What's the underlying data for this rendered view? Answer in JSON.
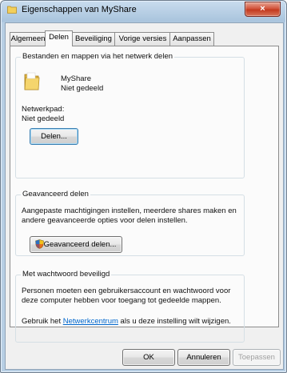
{
  "window": {
    "title": "Eigenschappen van MyShare",
    "close_glyph": "×"
  },
  "tabs": [
    {
      "label": "Algemeen"
    },
    {
      "label": "Delen"
    },
    {
      "label": "Beveiliging"
    },
    {
      "label": "Vorige versies"
    },
    {
      "label": "Aanpassen"
    }
  ],
  "active_tab": "Delen",
  "network_share": {
    "group_label": "Bestanden en mappen via het netwerk delen",
    "folder_name": "MyShare",
    "folder_status": "Niet gedeeld",
    "path_label": "Netwerkpad:",
    "path_value": "Niet gedeeld",
    "share_button": "Delen..."
  },
  "advanced": {
    "group_label": "Geavanceerd delen",
    "description": "Aangepaste machtigingen instellen, meerdere shares maken en andere geavanceerde opties voor delen instellen.",
    "button": "Geavanceerd delen..."
  },
  "password": {
    "group_label": "Met wachtwoord beveiligd",
    "description": "Personen moeten een gebruikersaccount en wachtwoord voor deze computer hebben voor toegang tot gedeelde mappen.",
    "hint_before": "Gebruik het ",
    "link": "Netwerkcentrum",
    "hint_after": " als u deze instelling wilt wijzigen."
  },
  "footer": {
    "ok": "OK",
    "cancel": "Annuleren",
    "apply": "Toepassen"
  },
  "colors": {
    "link": "#0066cc",
    "close_button": "#c33a1f"
  }
}
